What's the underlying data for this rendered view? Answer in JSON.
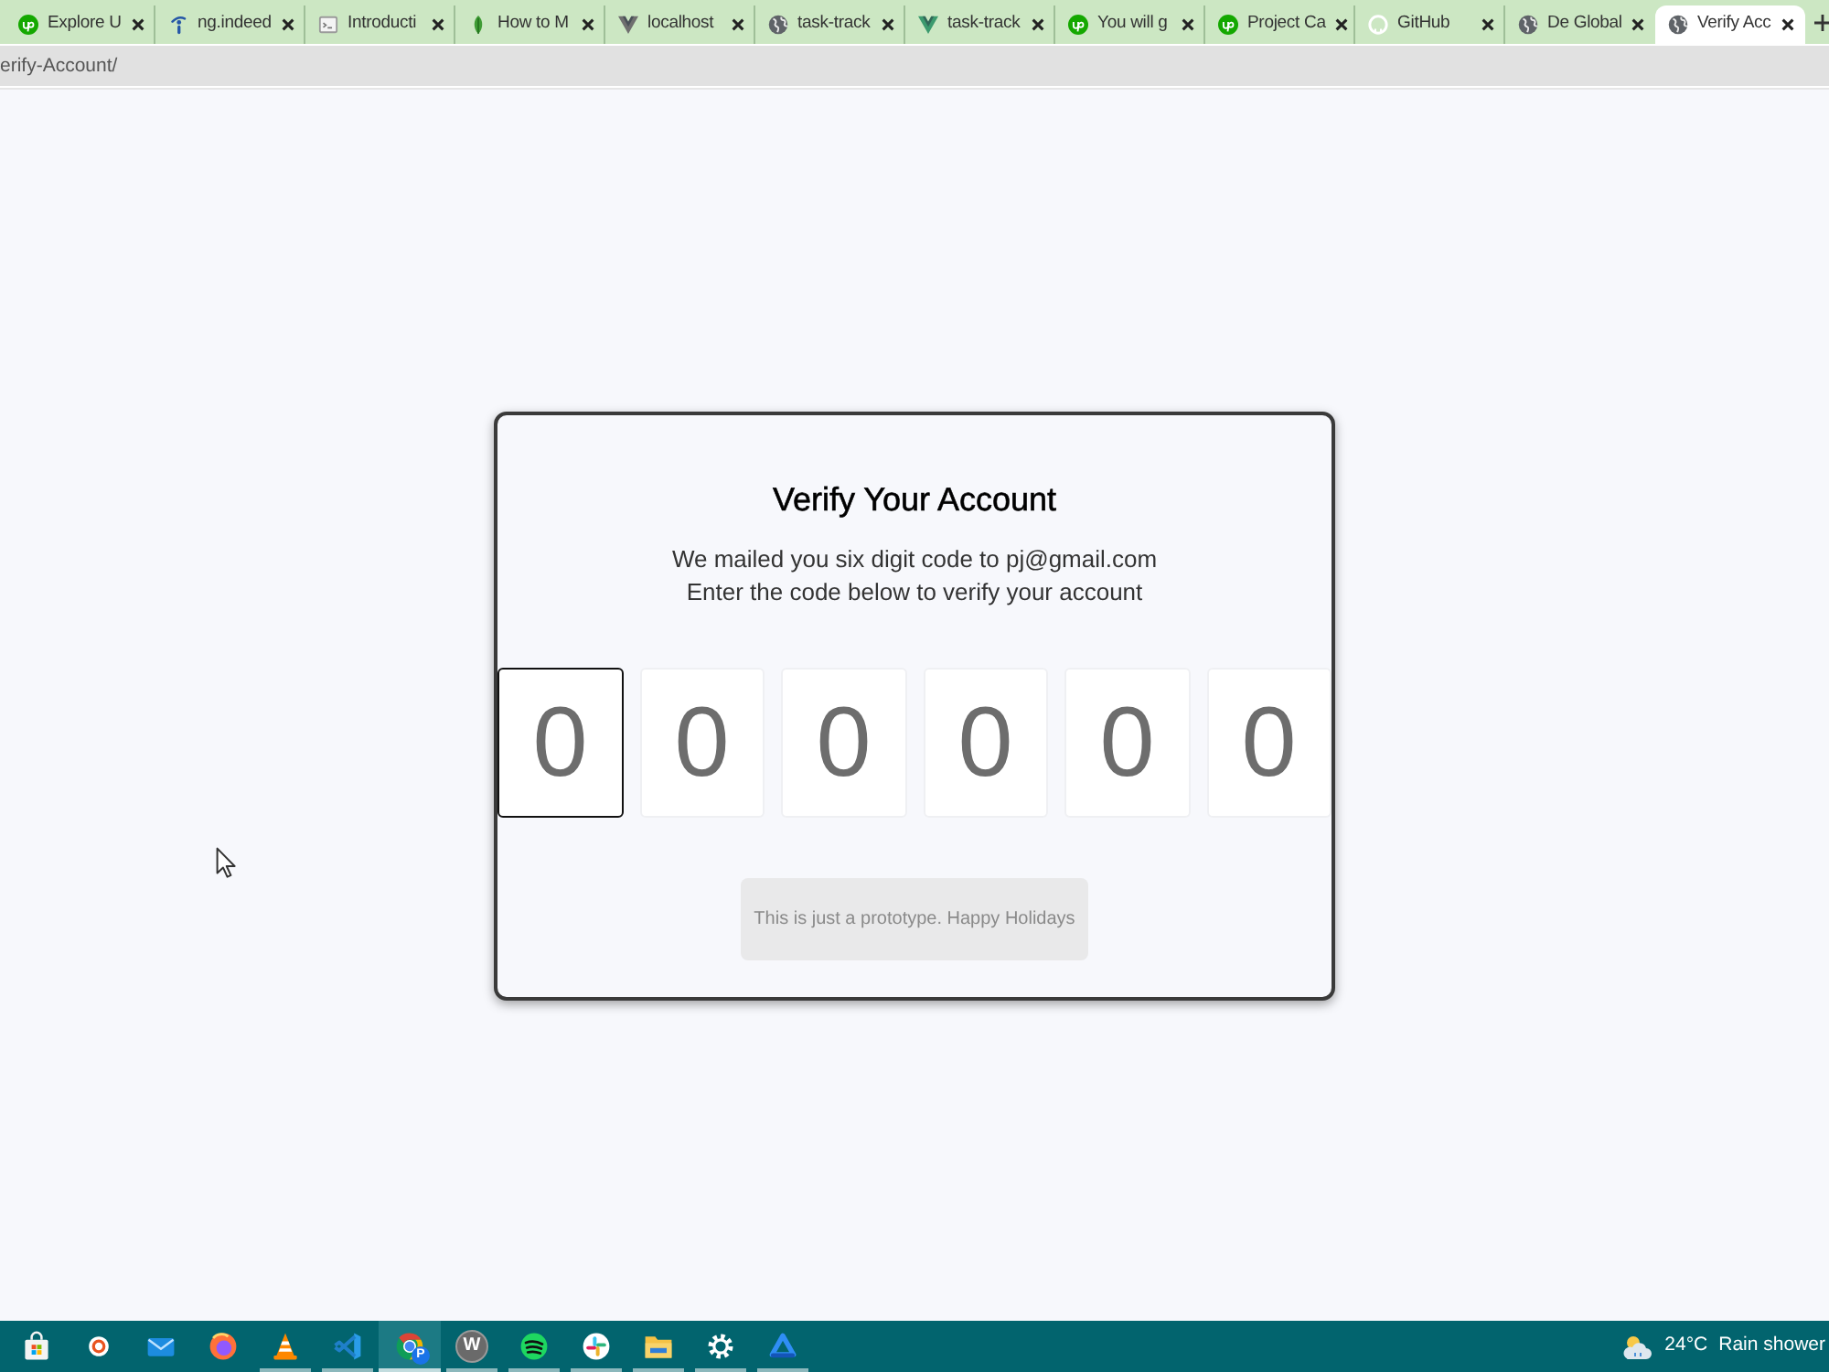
{
  "browser": {
    "tabs": [
      {
        "title": "Explore U",
        "kind": "badge",
        "selected": false
      },
      {
        "title": "ng.indeed",
        "kind": "pin",
        "selected": false
      },
      {
        "title": "Introducti",
        "kind": "terminal",
        "selected": false
      },
      {
        "title": "How to M",
        "kind": "leaf",
        "selected": false
      },
      {
        "title": "localhost",
        "kind": "vee",
        "color": "#6f6f6f",
        "selected": false
      },
      {
        "title": "task-track",
        "kind": "globe",
        "selected": false
      },
      {
        "title": "task-track",
        "kind": "vee",
        "color": "#3c9a6e",
        "selected": false
      },
      {
        "title": "You will g",
        "kind": "badge",
        "selected": false
      },
      {
        "title": "Project Ca",
        "kind": "badge",
        "selected": false
      },
      {
        "title": "GitHub",
        "kind": "octocat",
        "selected": false
      },
      {
        "title": "De Global",
        "kind": "globe",
        "selected": false
      },
      {
        "title": "Verify Acc",
        "kind": "globe",
        "selected": true
      }
    ],
    "address": "erify-Account/"
  },
  "card": {
    "title": "Verify Your Account",
    "lines": [
      "We mailed you six digit code to pj@gmail.com",
      "Enter the code below to verify your account"
    ],
    "code_fields": [
      {
        "placeholder": "0",
        "focused": true
      },
      {
        "placeholder": "0",
        "focused": false
      },
      {
        "placeholder": "0",
        "focused": false
      },
      {
        "placeholder": "0",
        "focused": false
      },
      {
        "placeholder": "0",
        "focused": false
      },
      {
        "placeholder": "0",
        "focused": false
      }
    ],
    "note": "This is just a prototype. Happy Holidays"
  },
  "taskbar": {
    "apps": [
      {
        "kind": "store",
        "running": false,
        "selected": false
      },
      {
        "kind": "ring",
        "running": false,
        "selected": false
      },
      {
        "kind": "envelope",
        "running": false,
        "selected": false
      },
      {
        "kind": "orb",
        "running": false,
        "selected": false
      },
      {
        "kind": "cone",
        "running": true,
        "selected": false
      },
      {
        "kind": "ribbon",
        "running": true,
        "selected": false
      },
      {
        "kind": "wheel",
        "badge": "P",
        "running": true,
        "selected": true
      },
      {
        "kind": "letter",
        "letter": "W",
        "running": true,
        "selected": false
      },
      {
        "kind": "waves",
        "running": true,
        "selected": false
      },
      {
        "kind": "pinwheel",
        "running": true,
        "selected": false
      },
      {
        "kind": "folder",
        "running": true,
        "selected": false
      },
      {
        "kind": "gear",
        "running": true,
        "selected": false
      },
      {
        "kind": "triangle",
        "running": true,
        "selected": false
      }
    ],
    "weather": {
      "temperature": "24°C",
      "summary": "Rain shower"
    }
  }
}
